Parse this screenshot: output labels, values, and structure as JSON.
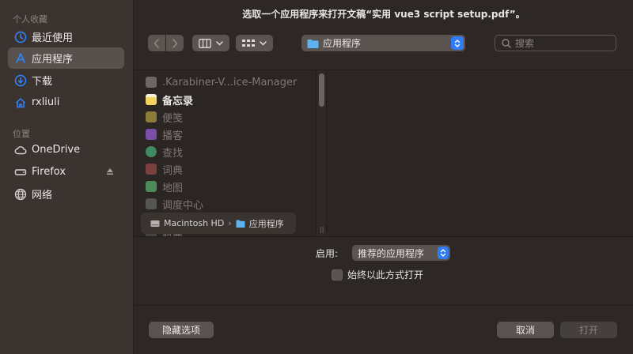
{
  "sidebar": {
    "favorites_header": "个人收藏",
    "favorites": [
      {
        "label": "最近使用",
        "icon": "clock-icon"
      },
      {
        "label": "应用程序",
        "icon": "applications-icon",
        "selected": true
      },
      {
        "label": "下载",
        "icon": "download-icon"
      },
      {
        "label": "rxliuli",
        "icon": "home-icon"
      }
    ],
    "locations_header": "位置",
    "locations": [
      {
        "label": "OneDrive",
        "icon": "cloud-icon"
      },
      {
        "label": "Firefox",
        "icon": "drive-icon",
        "eject": true
      },
      {
        "label": "网络",
        "icon": "network-icon"
      }
    ]
  },
  "dialog": {
    "title": "选取一个应用程序来打开文稿“实用 vue3 script setup.pdf”。"
  },
  "toolbar": {
    "location_label": "应用程序",
    "search_placeholder": "搜索"
  },
  "files": [
    {
      "label": ".Karabiner-V...ice-Manager",
      "dim": true,
      "color": "#6d6866"
    },
    {
      "label": "备忘录",
      "dim": false,
      "color": "#f4d35e"
    },
    {
      "label": "便笺",
      "dim": true,
      "color": "#8a7d3a"
    },
    {
      "label": "播客",
      "dim": true,
      "color": "#7b4fa8"
    },
    {
      "label": "查找",
      "dim": true,
      "color": "#3f8a5f"
    },
    {
      "label": "词典",
      "dim": true,
      "color": "#7a4040"
    },
    {
      "label": "地图",
      "dim": true,
      "color": "#4c8a5a"
    },
    {
      "label": "调度中心",
      "dim": true,
      "color": "#555"
    },
    {
      "label": "股票",
      "dim": true,
      "color": "#444"
    }
  ],
  "pathbar": {
    "drive": "Macintosh HD",
    "folder": "应用程序"
  },
  "options": {
    "enable_label": "启用:",
    "enable_value": "推荐的应用程序",
    "always_label": "始终以此方式打开"
  },
  "buttons": {
    "hide_options": "隐藏选项",
    "cancel": "取消",
    "open": "打开"
  }
}
